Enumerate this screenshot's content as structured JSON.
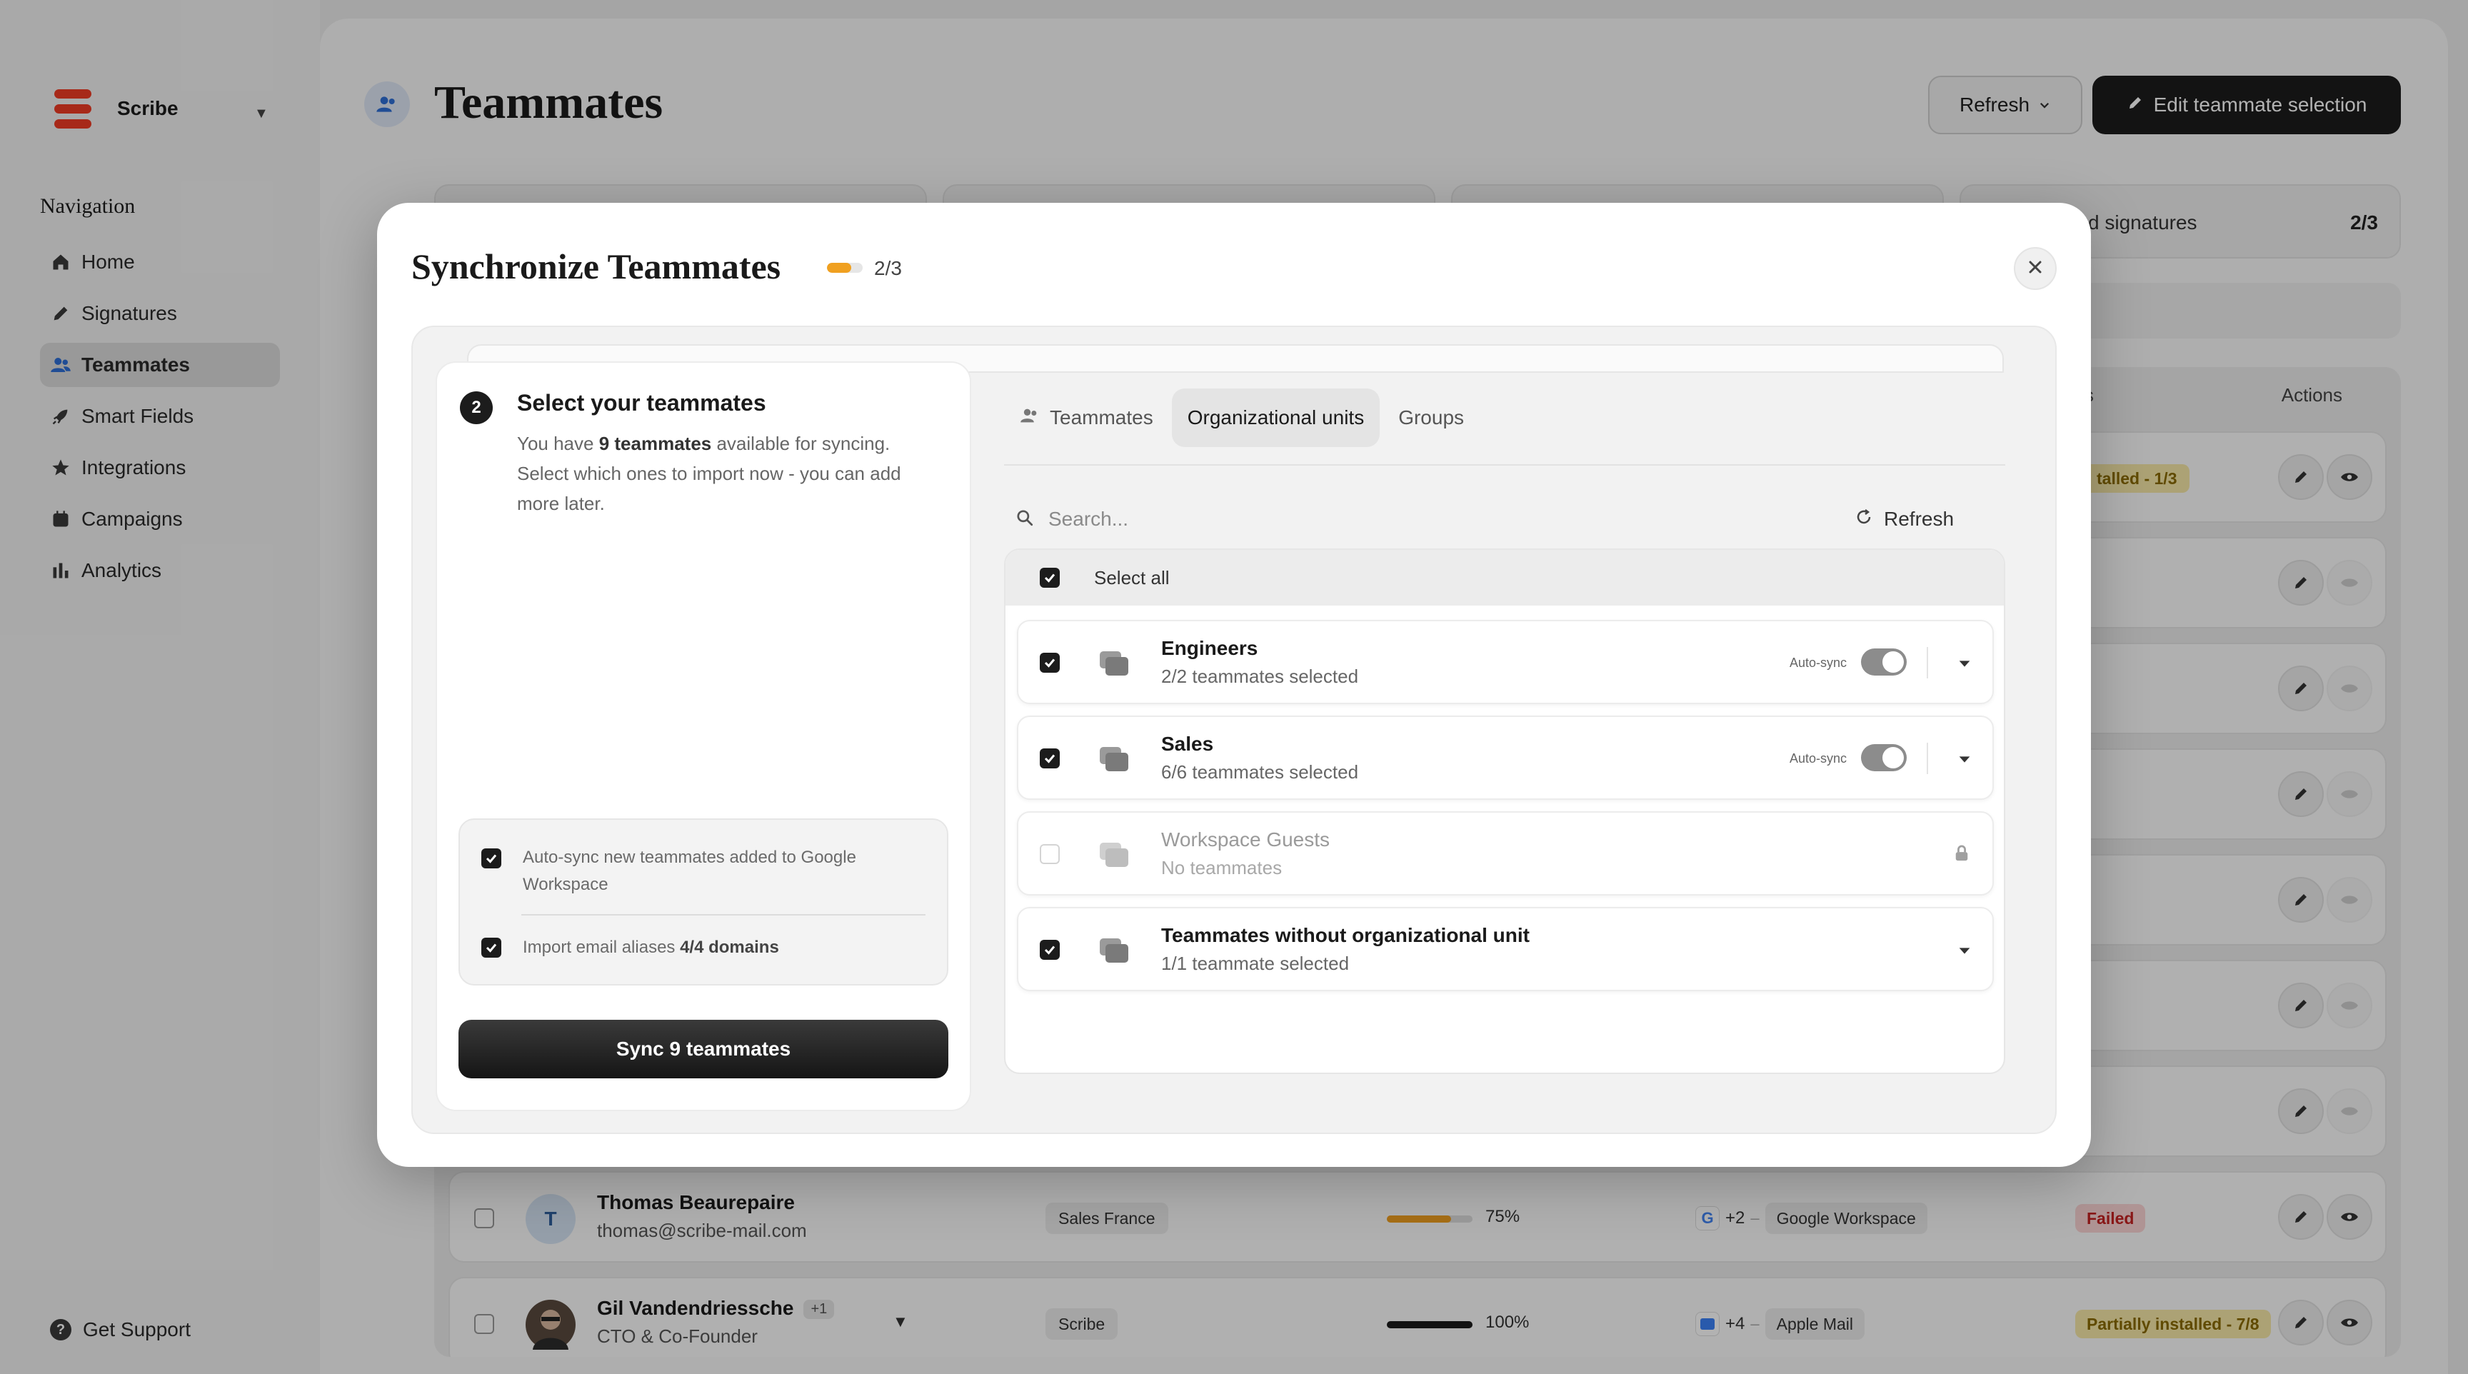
{
  "app": {
    "brand": "Scribe",
    "nav_title": "Navigation",
    "nav_items": [
      {
        "label": "Home",
        "icon": "home-icon"
      },
      {
        "label": "Signatures",
        "icon": "pen-icon"
      },
      {
        "label": "Teammates",
        "icon": "users-icon",
        "active": true
      },
      {
        "label": "Smart Fields",
        "icon": "rocket-icon"
      },
      {
        "label": "Integrations",
        "icon": "star-icon"
      },
      {
        "label": "Campaigns",
        "icon": "calendar-icon"
      },
      {
        "label": "Analytics",
        "icon": "bar-chart-icon"
      }
    ],
    "support": "Get Support"
  },
  "page": {
    "title": "Teammates",
    "refresh_label": "Refresh",
    "edit_label": "Edit teammate selection",
    "stat_visible_label": "d signatures",
    "stat_visible_value": "2/3",
    "table_status_header": "ons",
    "table_actions_header": "Actions",
    "first_row_status": "talled - 1/3",
    "rows": [
      {
        "initial": "T",
        "name": "Thomas Beaurepaire",
        "email": "thomas@scribe-mail.com",
        "team": "Sales France",
        "progress": 75,
        "progress_label": "75%",
        "client_count": "+2",
        "client_name": "Google Workspace",
        "status": "Failed"
      },
      {
        "initial": "",
        "name": "Gil Vandendriessche",
        "name_extra": "+1",
        "email": "CTO & Co-Founder",
        "team": "Scribe",
        "progress": 100,
        "progress_label": "100%",
        "client_count": "+4",
        "client_name": "Apple Mail",
        "status": "Partially installed - 7/8"
      }
    ]
  },
  "modal": {
    "title": "Synchronize Teammates",
    "step_progress": 0.67,
    "step_label": "2/3",
    "left": {
      "step_number": "2",
      "step_title": "Select your teammates",
      "desc_before": "You have ",
      "desc_bold": "9 teammates",
      "desc_after": " available for syncing. Select which ones to import now - you can add more later.",
      "option_autosync": "Auto-sync new teammates added to Google Workspace",
      "option_aliases_prefix": "Import email aliases ",
      "option_aliases_bold": "4/4 domains",
      "sync_button": "Sync 9 teammates"
    },
    "tabs": [
      {
        "label": "Teammates",
        "icon": "users-icon"
      },
      {
        "label": "Organizational units",
        "active": true
      },
      {
        "label": "Groups"
      }
    ],
    "search_placeholder": "Search...",
    "refresh_label": "Refresh",
    "select_all": "Select all",
    "units": [
      {
        "name": "Engineers",
        "sub": "2/2 teammates selected",
        "checked": true,
        "autosync": true
      },
      {
        "name": "Sales",
        "sub": "6/6 teammates selected",
        "checked": true,
        "autosync": true
      },
      {
        "name": "Workspace Guests",
        "sub": "No teammates",
        "checked": false,
        "locked": true
      },
      {
        "name": "Teammates without organizational unit",
        "sub": "1/1 teammate selected",
        "checked": true,
        "autosync": false
      }
    ],
    "autosync_label": "Auto-sync"
  },
  "colors": {
    "accent_orange": "#f0a020",
    "brand_red": "#ef3b24",
    "failed_red": "#c42222",
    "partial_yellow": "#8a6b00"
  }
}
